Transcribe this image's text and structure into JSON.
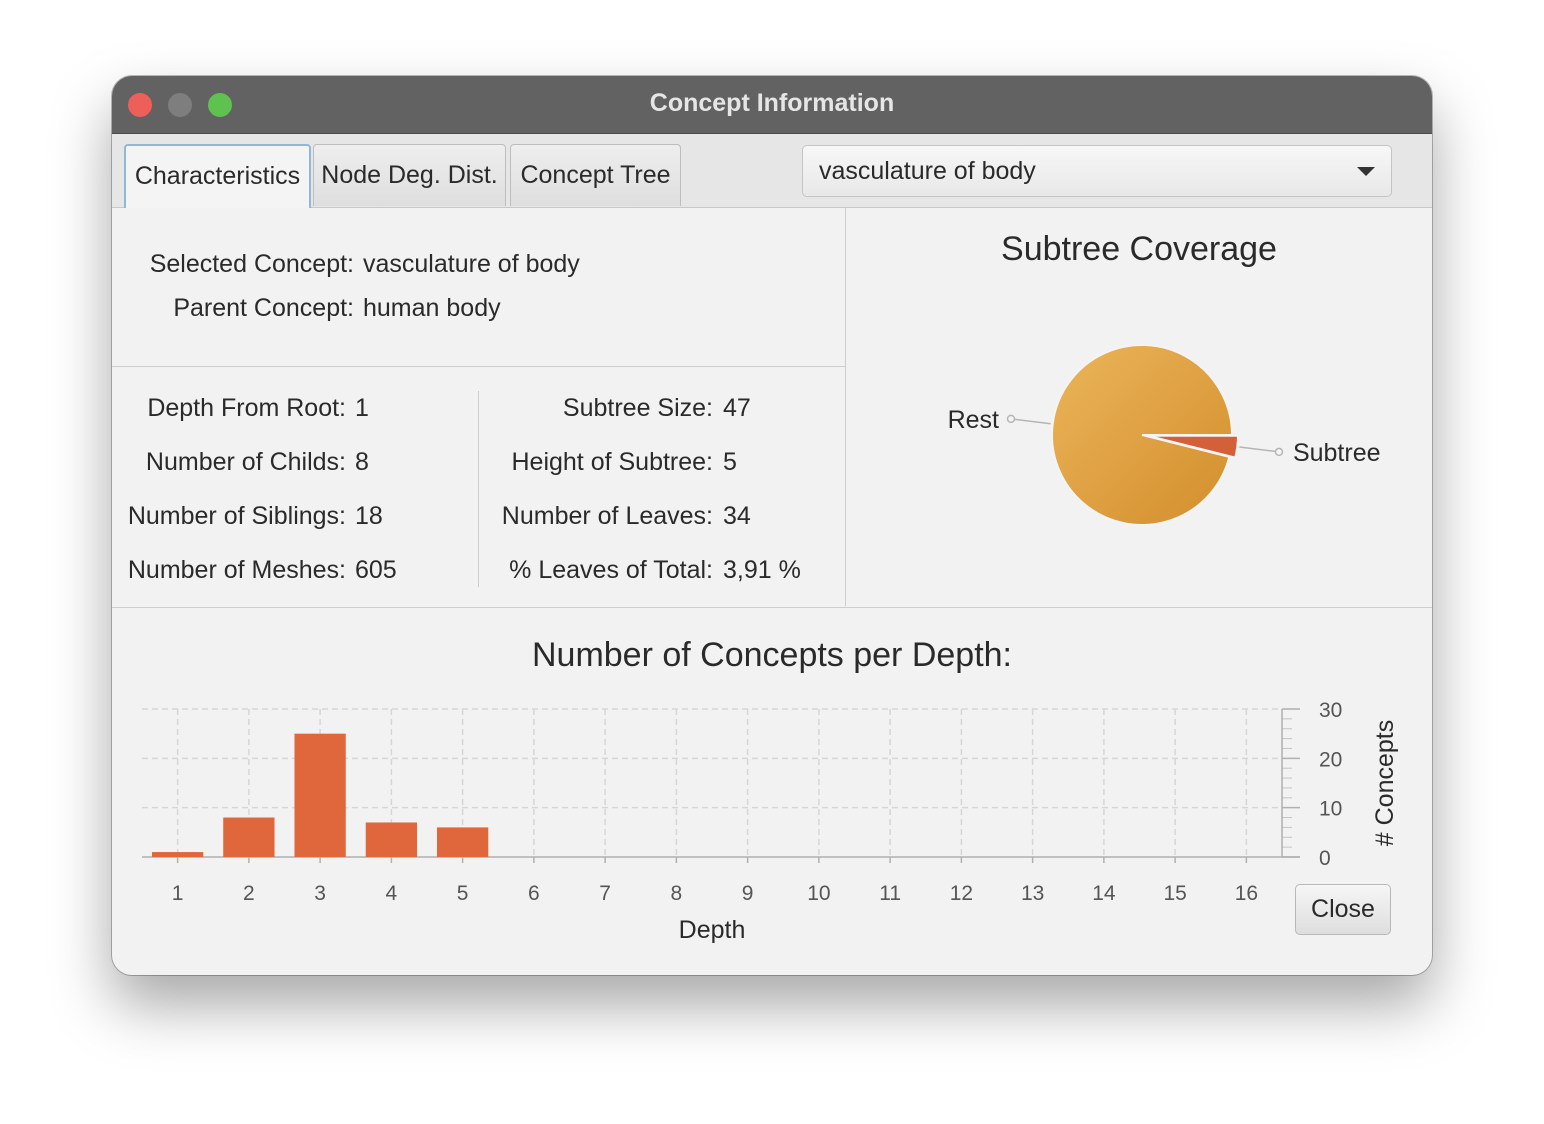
{
  "window": {
    "title": "Concept Information"
  },
  "tabs": [
    "Characteristics",
    "Node Deg. Dist.",
    "Concept Tree"
  ],
  "concept_select": {
    "value": "vasculature of body"
  },
  "info": {
    "selected_label": "Selected Concept:",
    "selected_value": "vasculature of body",
    "parent_label": "Parent Concept:",
    "parent_value": "human body"
  },
  "stats_left": [
    {
      "label": "Depth From Root:",
      "value": "1"
    },
    {
      "label": "Number of Childs:",
      "value": "8"
    },
    {
      "label": "Number of Siblings:",
      "value": "18"
    },
    {
      "label": "Number of Meshes:",
      "value": "605"
    }
  ],
  "stats_right": [
    {
      "label": "Subtree Size:",
      "value": "47"
    },
    {
      "label": "Height of Subtree:",
      "value": "5"
    },
    {
      "label": "Number of Leaves:",
      "value": "34"
    },
    {
      "label": "% Leaves of Total:",
      "value": "3,91 %"
    }
  ],
  "close_label": "Close",
  "colors": {
    "bar": "#e0663c",
    "pie_rest": "#e0a03e",
    "pie_subtree": "#d4603a"
  },
  "chart_data": [
    {
      "type": "pie",
      "title": "Subtree Coverage",
      "labels": [
        "Rest",
        "Subtree"
      ],
      "values": [
        96.09,
        3.91
      ]
    },
    {
      "type": "bar",
      "title": "Number of Concepts per Depth:",
      "xlabel": "Depth",
      "ylabel": "# Concepts",
      "categories": [
        "1",
        "2",
        "3",
        "4",
        "5",
        "6",
        "7",
        "8",
        "9",
        "10",
        "11",
        "12",
        "13",
        "14",
        "15",
        "16"
      ],
      "values": [
        1,
        8,
        25,
        7,
        6,
        0,
        0,
        0,
        0,
        0,
        0,
        0,
        0,
        0,
        0,
        0
      ],
      "ylim": [
        0,
        30
      ],
      "yticks": [
        "0",
        "10",
        "20",
        "30"
      ],
      "grid": true
    }
  ]
}
